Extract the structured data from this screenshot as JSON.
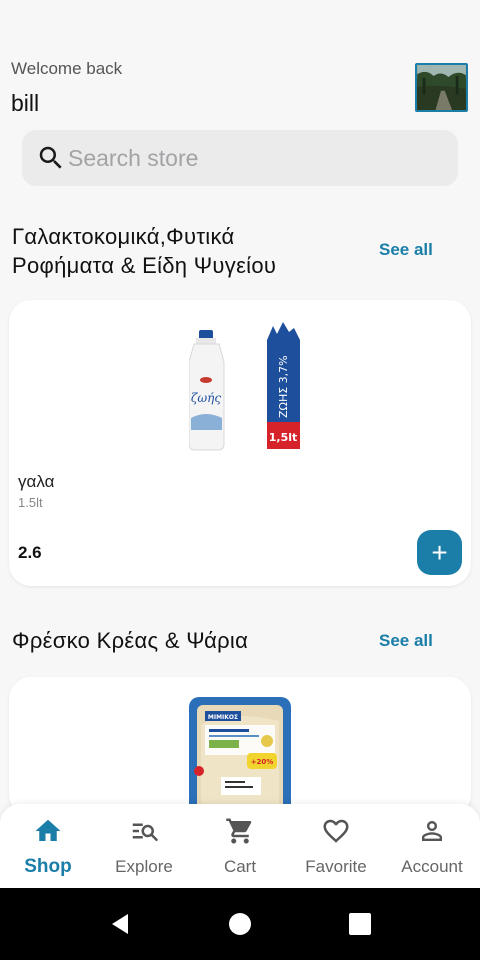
{
  "header": {
    "welcome_text": "Welcome back",
    "username": "bill",
    "avatar_icon": "profile-photo"
  },
  "search": {
    "placeholder": "Search store",
    "icon": "search-icon"
  },
  "sections": [
    {
      "title": "Γαλακτοκομικά,Φυτικά Ροφήματα & Είδη Ψυγείου",
      "see_all_label": "See all",
      "products": [
        {
          "name": "γαλα",
          "unit": "1.5lt",
          "price": "2.6",
          "add_label": "+",
          "image_text": "ζωής",
          "image_badge": "ΖΩΗΣ 3,7%",
          "image_volume": "1,5lt"
        }
      ]
    },
    {
      "title": "Φρέσκο Κρέας & Ψάρια",
      "see_all_label": "See all",
      "products": [
        {
          "image_brand": "ΜΙΜΙΚΟΣ",
          "image_offer": "+20%"
        }
      ]
    }
  ],
  "nav": {
    "items": [
      {
        "label": "Shop",
        "icon": "store-icon",
        "active": true
      },
      {
        "label": "Explore",
        "icon": "explore-search-icon",
        "active": false
      },
      {
        "label": "Cart",
        "icon": "cart-icon",
        "active": false
      },
      {
        "label": "Favorite",
        "icon": "heart-icon",
        "active": false
      },
      {
        "label": "Account",
        "icon": "person-icon",
        "active": false
      }
    ]
  },
  "colors": {
    "accent": "#1a7ea8",
    "background": "#f7f7f8",
    "card": "#ffffff",
    "search_bg": "#ebebec"
  }
}
